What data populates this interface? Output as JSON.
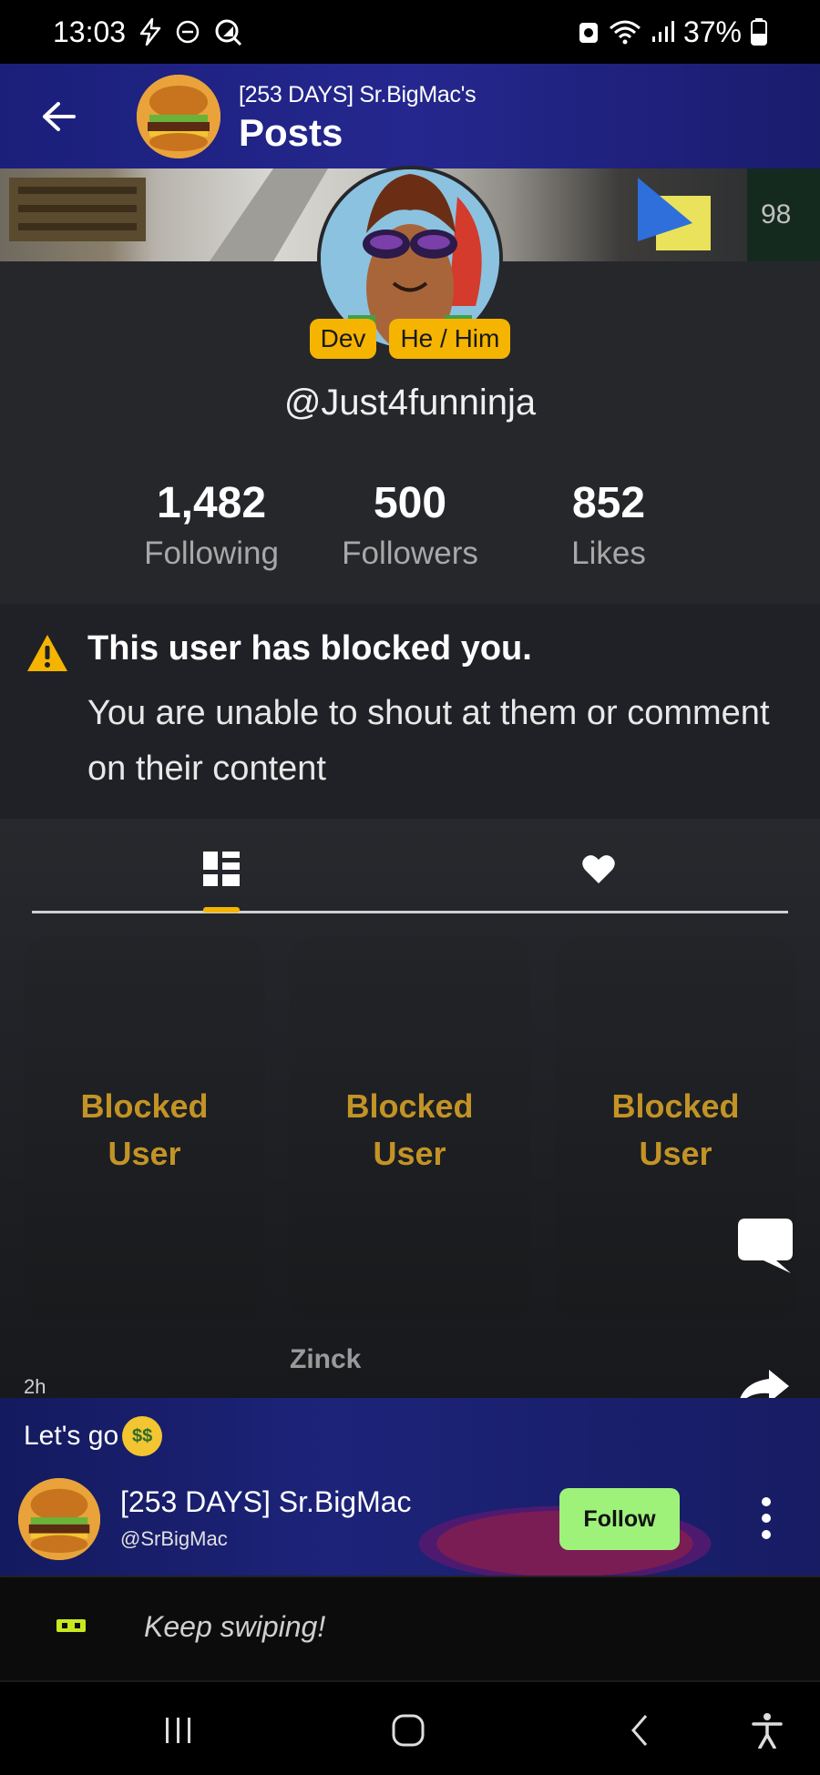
{
  "status_bar": {
    "time": "13:03",
    "battery": "37%"
  },
  "header": {
    "subtitle": "[253 DAYS] Sr.BigMac's",
    "title": "Posts"
  },
  "profile": {
    "badges": [
      "Dev",
      "He / Him"
    ],
    "username": "@Just4funninja",
    "stats": [
      {
        "value": "1,482",
        "label": "Following"
      },
      {
        "value": "500",
        "label": "Followers"
      },
      {
        "value": "852",
        "label": "Likes"
      }
    ]
  },
  "blocked_notice": {
    "title": "This user has blocked you.",
    "description": "You are unable to shout at them or comment on their content"
  },
  "tabs": [
    {
      "icon": "grid-layout-icon",
      "active": true
    },
    {
      "icon": "heart-icon",
      "active": false
    }
  ],
  "cards": [
    {
      "line1": "Blocked",
      "line2": "User"
    },
    {
      "line1": "Blocked",
      "line2": "User"
    },
    {
      "line1": "Blocked",
      "line2": "User"
    }
  ],
  "post": {
    "creator": "Zinck",
    "time": "2h",
    "caption": "Let's go",
    "author_name": "[253 DAYS] Sr.BigMac",
    "author_handle": "@SrBigMac",
    "follow_label": "Follow"
  },
  "swipe_hint": "Keep swiping!",
  "colors": {
    "accent": "#f5b400",
    "card_text": "#c39326",
    "follow_button": "#9ef27a",
    "background": "#26272b"
  }
}
